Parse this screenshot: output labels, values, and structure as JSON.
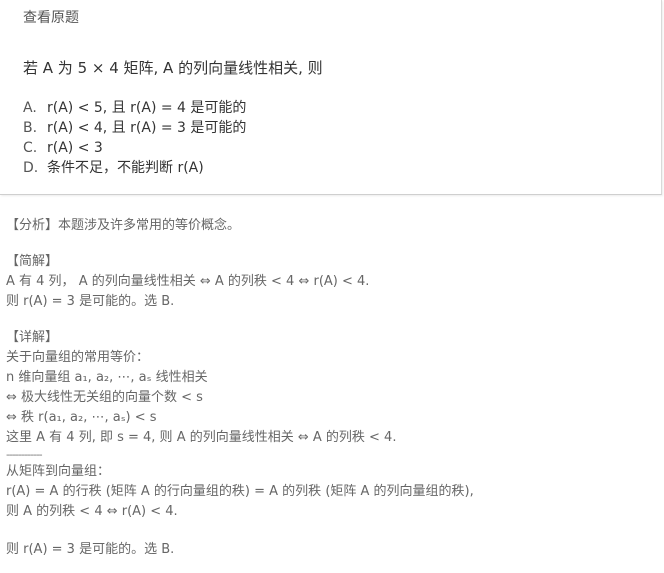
{
  "card": {
    "title": "查看原题",
    "question": "若 A 为 5 × 4 矩阵, A 的列向量线性相关, 则",
    "options": [
      {
        "letter": "A.",
        "text": "r(A) < 5, 且 r(A) = 4 是可能的"
      },
      {
        "letter": "B.",
        "text": "r(A) < 4, 且 r(A) = 3 是可能的"
      },
      {
        "letter": "C.",
        "text": "r(A) < 3"
      },
      {
        "letter": "D.",
        "text": "条件不足，不能判断 r(A)"
      }
    ]
  },
  "analysis": {
    "fenxi": "【分析】本题涉及许多常用的等价概念。",
    "jianjie_title": "【简解】",
    "jianjie_lines": [
      "A 有 4 列， A 的列向量线性相关 ⇔ A 的列秩 < 4 ⇔ r(A) < 4.",
      "则 r(A) = 3 是可能的。选 B."
    ],
    "xiangjie_title": "【详解】",
    "xiangjie_lines": [
      "关于向量组的常用等价：",
      "n 维向量组 a₁, a₂, ⋯, aₛ 线性相关",
      "⇔ 极大线性无关组的向量个数 < s",
      "⇔ 秩 r(a₁, a₂, ⋯, aₛ) < s",
      "这里 A 有 4 列, 即 s = 4, 则 A 的列向量线性相关 ⇔ A 的列秩 < 4."
    ],
    "separator": "------------",
    "matrix_lines": [
      "从矩阵到向量组：",
      "r(A) = A 的行秩 (矩阵 A 的行向量组的秩) = A 的列秩 (矩阵 A 的列向量组的秩),",
      "则 A 的列秩 < 4 ⇔ r(A) < 4."
    ],
    "conclusion": "则 r(A) = 3 是可能的。选 B."
  }
}
